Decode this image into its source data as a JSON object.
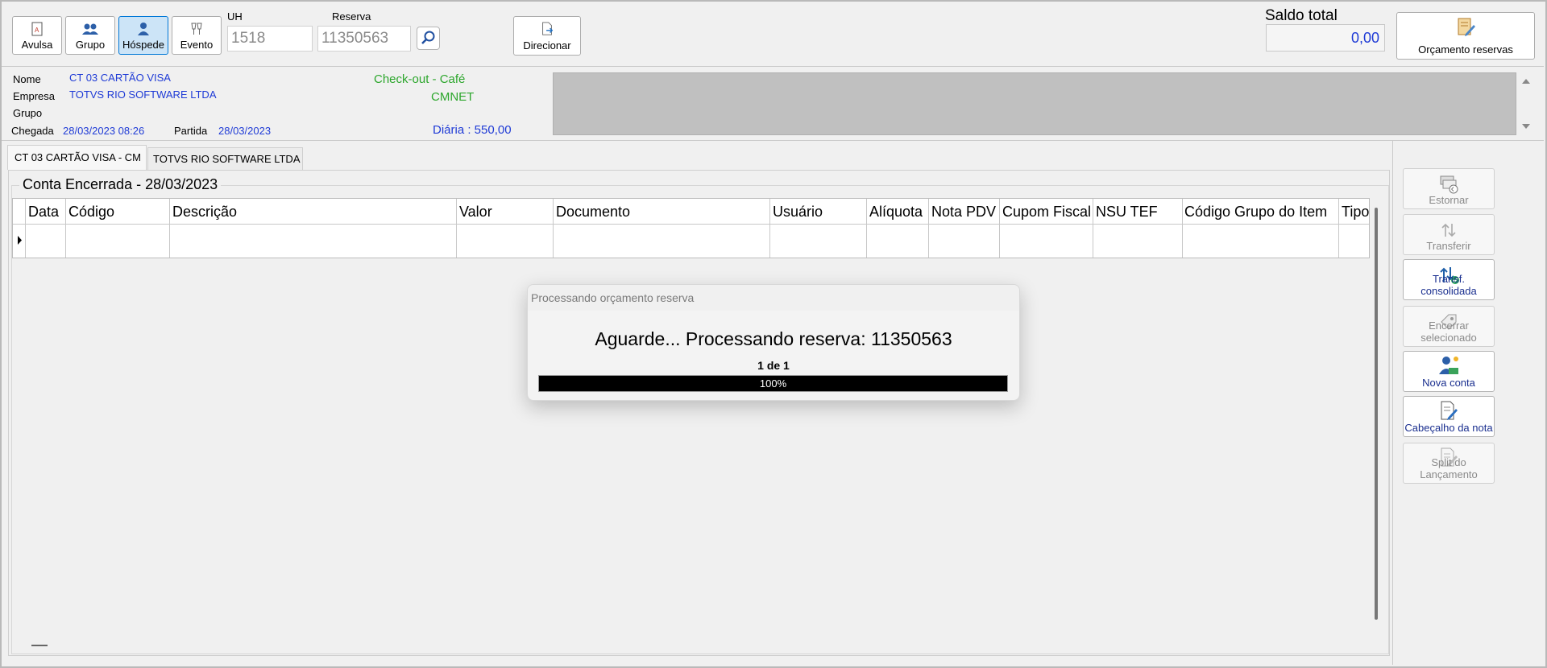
{
  "toolbar": {
    "avulsa": "Avulsa",
    "grupo": "Grupo",
    "hospede": "Hóspede",
    "evento": "Evento",
    "uh_label": "UH",
    "uh_value": "1518",
    "reserva_label": "Reserva",
    "reserva_value": "11350563",
    "direcionar": "Direcionar",
    "saldo_label": "Saldo total",
    "saldo_value": "0,00",
    "orcamento": "Orçamento reservas"
  },
  "info": {
    "nome_label": "Nome",
    "nome_value": "CT 03 CARTÃO VISA",
    "empresa_label": "Empresa",
    "empresa_value": "TOTVS RIO SOFTWARE LTDA",
    "grupo_label": "Grupo",
    "chegada_label": "Chegada",
    "chegada_value": "28/03/2023 08:26",
    "partida_label": "Partida",
    "partida_value": "28/03/2023",
    "checkout": "Check-out -  Café",
    "cmnet": "CMNET",
    "diaria": "Diária : 550,00"
  },
  "tabs": [
    "CT 03 CARTÃO VISA - CM",
    "TOTVS RIO SOFTWARE LTDA"
  ],
  "account": {
    "title": "Conta Encerrada - 28/03/2023",
    "columns": [
      "Data",
      "Código",
      "Descrição",
      "Valor",
      "Documento",
      "Usuário",
      "Alíquota",
      "Nota PDV",
      "Cupom Fiscal",
      "NSU TEF",
      "Código Grupo do Item",
      "Tipo"
    ]
  },
  "actions": {
    "estornar": "Estornar",
    "transferir": "Transferir",
    "transf_consolidada": "Transf. consolidada",
    "encerrar": "Encerrar selecionado",
    "nova_conta": "Nova conta",
    "cabecalho": "Cabeçalho da nota",
    "split": "Split do Lançamento"
  },
  "dialog": {
    "title": "Processando orçamento reserva",
    "message": "Aguarde... Processando reserva: 11350563",
    "counter": "1 de 1",
    "progress_label": "100%",
    "progress": 1.0
  },
  "colors": {
    "link_blue": "#1f3bd6",
    "status_green": "#2ca62c",
    "active_button": "#cce4f7"
  }
}
